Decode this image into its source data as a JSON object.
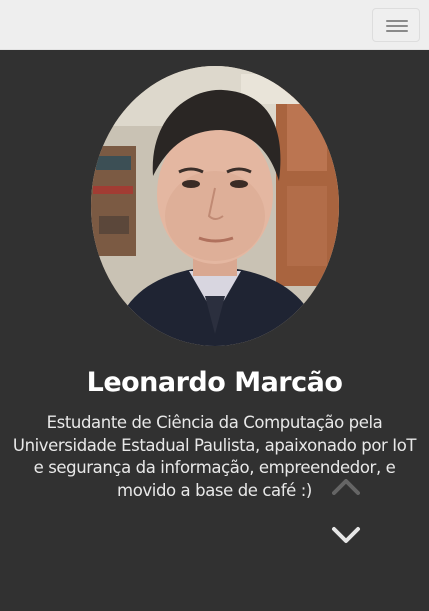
{
  "navbar": {
    "menu_icon": "hamburger-menu-icon",
    "background": "#eeeeee"
  },
  "profile": {
    "photo_alt": "profile-photo",
    "name": "Leonardo Marcão",
    "bio": "Estudante de Ciência da Computação pela Universidade Estadual Paulista, apaixonado por IoT e segurança da informação, empreendedor, e movido a base de café :)"
  },
  "controls": {
    "scroll_up_icon": "chevron-up-icon",
    "scroll_down_icon": "chevron-down-icon"
  },
  "colors": {
    "page_background": "#313131",
    "text": "#ffffff"
  }
}
